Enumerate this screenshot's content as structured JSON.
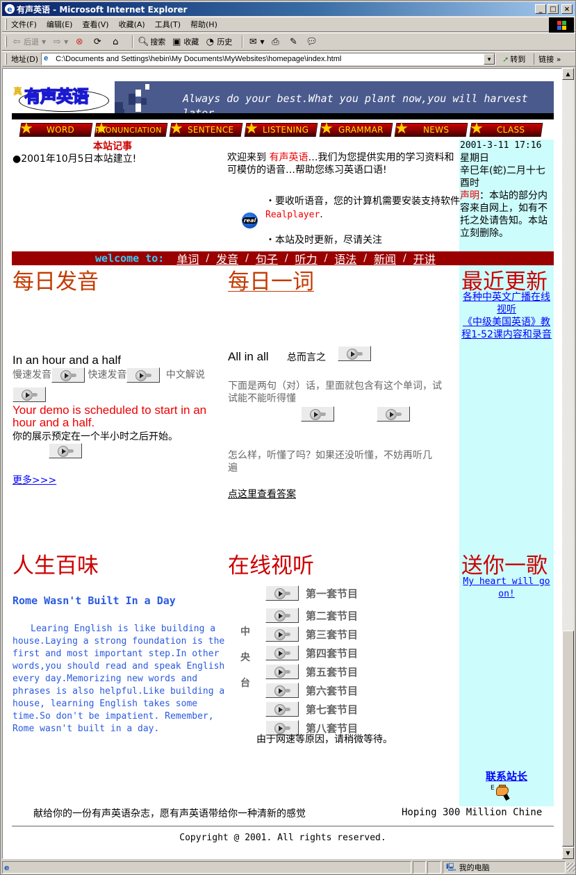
{
  "window": {
    "title": "有声英语 - Microsoft Internet Explorer",
    "minimize": "_",
    "maximize": "□",
    "close": "×"
  },
  "menu": [
    "文件(F)",
    "编辑(E)",
    "查看(V)",
    "收藏(A)",
    "工具(T)",
    "帮助(H)"
  ],
  "toolbar": {
    "back": "后退",
    "search": "搜索",
    "favorites": "收藏",
    "history": "历史"
  },
  "address": {
    "label": "地址(D)",
    "value": "C:\\Documents and Settings\\hebin\\My Documents\\MyWebsites\\homepage\\index.html",
    "go": "转到",
    "links": "链接"
  },
  "page": {
    "banner": {
      "logo": "有声英语",
      "logo_prefix": "真",
      "slogan": "Always do your best.What you plant now,you will harvest later."
    },
    "nav": [
      "WORD",
      "PRONUNCIATION",
      "SENTENCE",
      "LISTENING",
      "GRAMMAR",
      "NEWS",
      "CLASS"
    ],
    "notes": {
      "title": "本站记事",
      "items": [
        "●2001年10月5日本站建立!"
      ]
    },
    "welcome": {
      "prefix": "欢迎来到 ",
      "brand": "有声英语",
      "suffix": "…我们为您提供实用的学习资料和可模仿的语音…帮助您练习英语口语!",
      "bullet1_a": "・要收听语音，您的计算机需要安装支持软件",
      "bullet1_link": "Realplayer",
      "bullet1_b": ".",
      "real_icon": "real",
      "bullet2": "・本站及时更新，尽请关注"
    },
    "sidebar_info": {
      "datetime": "2001-3-11 17:16",
      "weekday": "星期日",
      "lunar": "辛巳年(蛇)二月十七酉时",
      "notice_label": "声明",
      "notice_text": "：本站的部分内容来自网上，如有不托之处请告知。本站立刻删除。"
    },
    "welcome_bar": {
      "label": "welcome to:",
      "links": [
        "单词",
        "发音",
        "句子",
        "听力",
        "语法",
        "新闻",
        "开讲"
      ],
      "separator": "/"
    },
    "daily_pron": {
      "title": "每日发音",
      "phrase": "In an hour and a half",
      "slow": "慢速发音",
      "fast": "快速发音",
      "explain": "中文解说",
      "sentence_en": "Your demo is scheduled to start in an hour and a half.",
      "sentence_zh": "你的展示预定在一个半小时之后开始。",
      "more": "更多>>>"
    },
    "daily_word": {
      "title": "每日一词",
      "word": "All in all",
      "meaning": "总而言之",
      "desc": "下面是两句（对）话，里面就包含有这个单词，试试能不能听得懂",
      "question": "怎么样，听懂了吗？如果还没听懂，不妨再听几遍",
      "answer_link": "点这里查看答案"
    },
    "recent": {
      "title": "最近更新",
      "links": [
        "各种中英文广播在线视听",
        "《中级美国英语》教程1-52课内容和录音"
      ]
    },
    "life": {
      "title": "人生百味",
      "article_title": "Rome Wasn't Built In a Day",
      "article": "Learing English is like building a house.Laying a strong foundation is the first and most important step.In other words,you should read and speak English every day.Memorizing new words and phrases is also helpful.Like building a house, learning English takes some time.So don't be impatient. Remember, Rome wasn't built in a day."
    },
    "online": {
      "title": "在线视听",
      "station": [
        "中",
        "央",
        "台"
      ],
      "programs": [
        "第一套节目",
        "第二套节目",
        "第三套节目",
        "第四套节目",
        "第五套节目",
        "第六套节目",
        "第七套节目",
        "第八套节目"
      ],
      "note": "由于网速等原因，请稍微等待。"
    },
    "song": {
      "title": "送你一歌",
      "link": "My heart will go on!"
    },
    "contact": {
      "label": "联系站长",
      "icon_letter": "E"
    },
    "footer": {
      "dedication": "献给你的一份有声英语杂志，愿有声英语带给你一种清新的感觉",
      "marquee": "Hoping 300 Million Chine",
      "copyright": "Copyright @ 2001. All rights reserved."
    }
  },
  "status": {
    "zone": "我的电脑"
  }
}
